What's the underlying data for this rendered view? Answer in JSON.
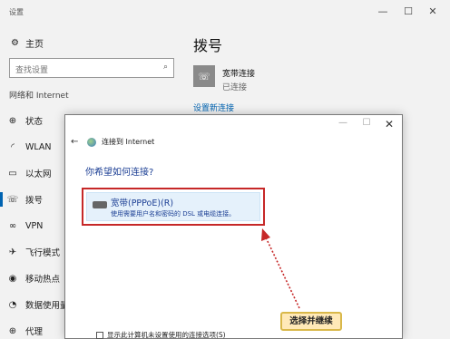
{
  "window": {
    "title": "设置",
    "min": "—",
    "max": "☐",
    "close": "✕"
  },
  "nav": {
    "home": {
      "label": "主页",
      "icon": "gear-icon",
      "glyph": "⚙"
    },
    "search": {
      "placeholder": "查找设置",
      "icon": "search-icon",
      "glyph": "⌕"
    },
    "group": "网络和 Internet",
    "items": [
      {
        "label": "状态",
        "icon": "globe-icon",
        "glyph": "⊕"
      },
      {
        "label": "WLAN",
        "icon": "wifi-icon",
        "glyph": "◜"
      },
      {
        "label": "以太网",
        "icon": "monitor-icon",
        "glyph": "▭"
      },
      {
        "label": "拨号",
        "icon": "phone-icon",
        "glyph": "☏",
        "active": true
      },
      {
        "label": "VPN",
        "icon": "vpn-icon",
        "glyph": "∞"
      },
      {
        "label": "飞行模式",
        "icon": "airplane-icon",
        "glyph": "✈"
      },
      {
        "label": "移动热点",
        "icon": "hotspot-icon",
        "glyph": "◉"
      },
      {
        "label": "数据使用量",
        "icon": "data-usage-icon",
        "glyph": "◔"
      },
      {
        "label": "代理",
        "icon": "proxy-icon",
        "glyph": "⊕"
      }
    ]
  },
  "content": {
    "title": "拨号",
    "connection": {
      "name": "宽带连接",
      "state": "已连接",
      "icon": "dialup-icon",
      "glyph": "☏"
    },
    "setup_link": "设置新连接"
  },
  "dialog": {
    "header": "连接到 Internet",
    "min": "—",
    "max": "☐",
    "close": "✕",
    "back": "←",
    "question": "你希望如何连接?",
    "option": {
      "title": "宽带(PPPoE)(R)",
      "desc": "使用需要用户名和密码的 DSL 或电缆连接。",
      "icon": "modem-icon"
    },
    "checkbox": "显示此计算机未设置使用的连接选项(S)"
  },
  "annotation": {
    "text": "选择并继续",
    "color": "#c62828"
  }
}
